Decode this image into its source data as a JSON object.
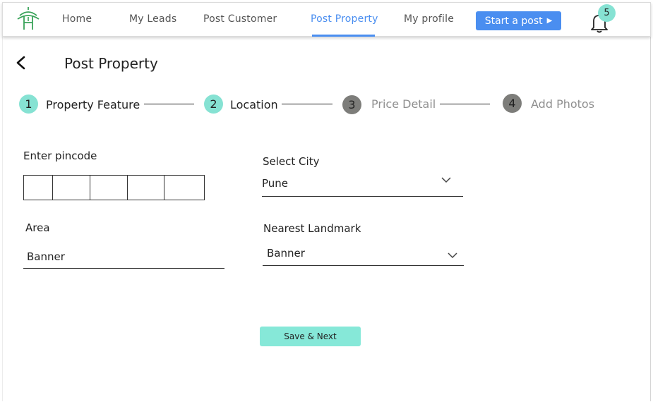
{
  "nav": {
    "links": [
      "Home",
      "My Leads",
      "Post  Customer",
      "Post Property",
      "My profile"
    ],
    "active_link": "Post Property",
    "start_post_label": "Start a post",
    "notification_count": "5"
  },
  "header": {
    "title": "Post Property"
  },
  "stepper": {
    "steps": [
      {
        "number": "1",
        "label": "Property Feature",
        "state": "completed"
      },
      {
        "number": "2",
        "label": "Location",
        "state": "current"
      },
      {
        "number": "3",
        "label": "Price Detail",
        "state": "pending"
      },
      {
        "number": "4",
        "label": "Add Photos",
        "state": "pending"
      }
    ]
  },
  "form": {
    "pincode_label": "Enter pincode",
    "pincode_boxes": 5,
    "city_label": "Select City",
    "city_value": "Pune",
    "area_label": "Area",
    "area_value": "Banner",
    "landmark_label": "Nearest Landmark",
    "landmark_value": "Banner",
    "save_label": "Save & Next"
  },
  "colors": {
    "accent_blue": "#4a8ef0",
    "step_done": "#86e2d3",
    "step_pending": "#7d7d7a",
    "button_teal": "#86e8d8"
  }
}
